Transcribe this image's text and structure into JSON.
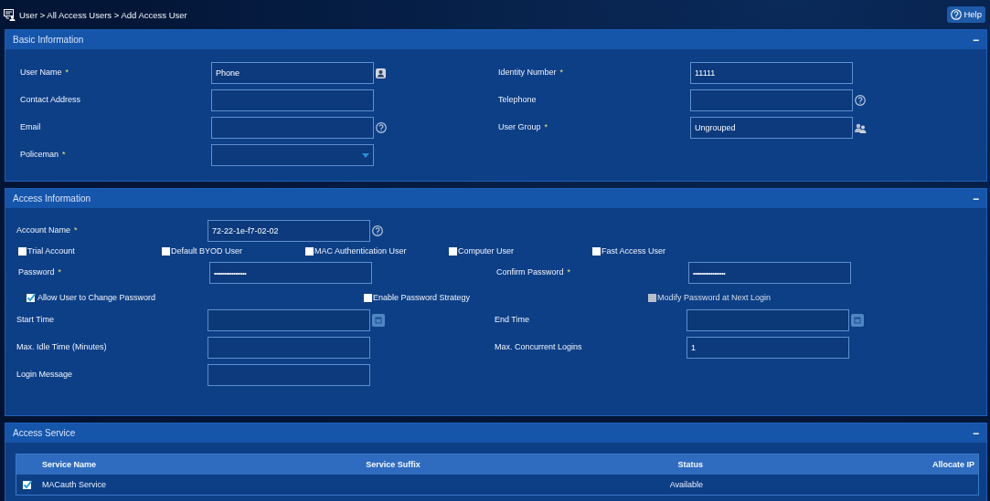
{
  "breadcrumb": "User > All Access Users > Add Access User",
  "help_button": {
    "label": "Help"
  },
  "panels": [
    {
      "title": "Basic Information",
      "collapse": "−",
      "rows": [
        {
          "kind": "pair",
          "left": {
            "label": "User Name",
            "required_mark": "*",
            "kind": "contact",
            "value": "Phone"
          },
          "right": {
            "label": "Identity Number",
            "required_mark": "*",
            "kind": "text",
            "value": "11111"
          }
        },
        {
          "kind": "pair",
          "left": {
            "label": "Contact Address",
            "kind": "text"
          },
          "right": {
            "label": "Telephone",
            "kind": "help"
          }
        },
        {
          "kind": "pair",
          "left": {
            "label": "Email",
            "kind": "help"
          },
          "right": {
            "label": "User Group",
            "required_mark": "*",
            "kind": "group",
            "value": "Ungrouped"
          }
        },
        {
          "kind": "pair",
          "left": {
            "label": "Policeman",
            "required_mark": "*",
            "kind": "select"
          }
        }
      ]
    },
    {
      "title": "Access Information",
      "collapse": "−",
      "rows": [
        {
          "kind": "pair",
          "left": {
            "label": "Account Name",
            "required_mark": "*",
            "kind": "help",
            "value": "72-22-1e-f7-02-02"
          }
        },
        {
          "kind": "checks",
          "items": [
            {
              "label": "Trial Account",
              "checked": false,
              "disabled": false
            },
            {
              "label": "Default BYOD User",
              "checked": false,
              "disabled": false
            },
            {
              "label": "MAC Authentication User",
              "checked": false,
              "disabled": false
            },
            {
              "label": "Computer User",
              "checked": false,
              "disabled": false
            },
            {
              "label": "Fast Access User",
              "checked": false,
              "disabled": false
            }
          ]
        },
        {
          "kind": "pair",
          "left": {
            "label": "Password",
            "required_mark": "*",
            "kind": "password",
            "value": "••••••••••••••••••"
          },
          "right": {
            "label": "Confirm Password",
            "required_mark": "*",
            "kind": "password",
            "value": "••••••••••••••••••"
          }
        },
        {
          "kind": "options",
          "items": [
            {
              "label": "Allow User to Change Password",
              "checked": true,
              "disabled": false
            },
            {
              "label": "Enable Password Strategy",
              "checked": false,
              "disabled": false
            },
            {
              "label": "Modify Password at Next Login",
              "checked": false,
              "disabled": true
            }
          ]
        },
        {
          "kind": "pair",
          "left": {
            "label": "Start Time",
            "kind": "date"
          },
          "right": {
            "label": "End Time",
            "kind": "date"
          }
        },
        {
          "kind": "pair",
          "left": {
            "label": "Max. Idle Time (Minutes)",
            "kind": "text"
          },
          "right": {
            "label": "Max. Concurrent Logins",
            "kind": "text",
            "value": "1"
          }
        },
        {
          "kind": "pair",
          "left": {
            "label": "Login Message",
            "kind": "text"
          }
        }
      ]
    }
  ],
  "access_service": {
    "title": "Access Service",
    "collapse": "−",
    "table": {
      "columns": [
        "Service Name",
        "Service Suffix",
        "Status",
        "Allocate IP"
      ],
      "rows": [
        {
          "selected": true,
          "service_name": "MACauth Service",
          "status": "Available"
        }
      ]
    }
  }
}
